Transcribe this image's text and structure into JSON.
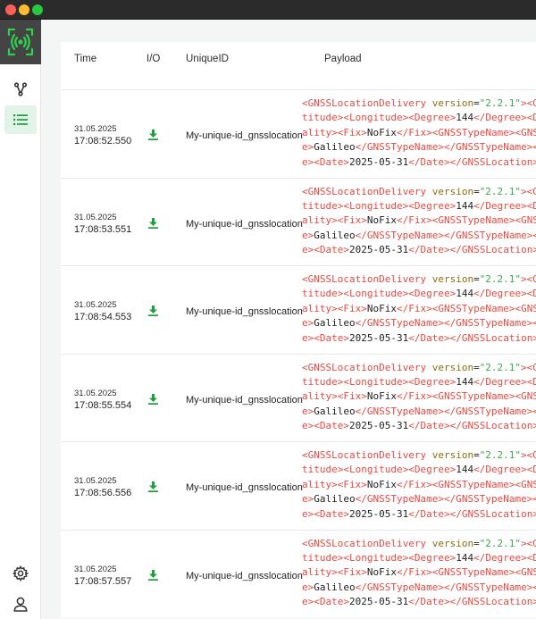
{
  "colors": {
    "accent": "#1f9d3f",
    "tag": "#e14b43",
    "attr": "#8a6d14",
    "string": "#3ea84a"
  },
  "sidebar": {
    "logo_icon": "antenna-scan-icon",
    "items": [
      {
        "name": "graph-icon",
        "active": false
      },
      {
        "name": "list-icon",
        "active": true
      }
    ],
    "bottom": [
      {
        "name": "gear-icon"
      },
      {
        "name": "user-icon"
      }
    ]
  },
  "table": {
    "headers": {
      "time": "Time",
      "io": "I/O",
      "unique_id": "UniqueID",
      "payload": "Payload"
    },
    "rows": [
      {
        "date": "31.05.2025",
        "time": "17:08:52.550",
        "io_icon": "download-icon",
        "unique_id": "My-unique-id_gnsslocation"
      },
      {
        "date": "31.05.2025",
        "time": "17:08:53.551",
        "io_icon": "download-icon",
        "unique_id": "My-unique-id_gnsslocation"
      },
      {
        "date": "31.05.2025",
        "time": "17:08:54.553",
        "io_icon": "download-icon",
        "unique_id": "My-unique-id_gnsslocation"
      },
      {
        "date": "31.05.2025",
        "time": "17:08:55.554",
        "io_icon": "download-icon",
        "unique_id": "My-unique-id_gnsslocation"
      },
      {
        "date": "31.05.2025",
        "time": "17:08:56.556",
        "io_icon": "download-icon",
        "unique_id": "My-unique-id_gnsslocation"
      },
      {
        "date": "31.05.2025",
        "time": "17:08:57.557",
        "io_icon": "download-icon",
        "unique_id": "My-unique-id_gnsslocation"
      }
    ],
    "payload_lines": [
      [
        [
          "t",
          "<"
        ],
        [
          "t",
          "GNSSLocationDelivery"
        ],
        [
          "b",
          " "
        ],
        [
          "a",
          "version"
        ],
        [
          "b",
          "="
        ],
        [
          "s",
          "\"2.2.1\""
        ],
        [
          "t",
          ">"
        ],
        [
          "t",
          "<"
        ],
        [
          "t",
          "GNSS"
        ]
      ],
      [
        [
          "t",
          "titude"
        ],
        [
          "t",
          ">"
        ],
        [
          "t",
          "<"
        ],
        [
          "t",
          "Longitude"
        ],
        [
          "t",
          ">"
        ],
        [
          "t",
          "<"
        ],
        [
          "t",
          "Degree"
        ],
        [
          "t",
          ">"
        ],
        [
          "b",
          "144"
        ],
        [
          "t",
          "</"
        ],
        [
          "t",
          "Degree"
        ],
        [
          "t",
          ">"
        ],
        [
          "t",
          "<"
        ],
        [
          "t",
          "Di"
        ]
      ],
      [
        [
          "t",
          "ality"
        ],
        [
          "t",
          ">"
        ],
        [
          "t",
          "<"
        ],
        [
          "t",
          "Fix"
        ],
        [
          "t",
          ">"
        ],
        [
          "b",
          "NoFix"
        ],
        [
          "t",
          "</"
        ],
        [
          "t",
          "Fix"
        ],
        [
          "t",
          ">"
        ],
        [
          "t",
          "<"
        ],
        [
          "t",
          "GNSSTypeName"
        ],
        [
          "t",
          ">"
        ],
        [
          "t",
          "<"
        ],
        [
          "t",
          "GNSST"
        ]
      ],
      [
        [
          "t",
          "e"
        ],
        [
          "t",
          ">"
        ],
        [
          "b",
          "Galileo"
        ],
        [
          "t",
          "</"
        ],
        [
          "t",
          "GNSSTypeName"
        ],
        [
          "t",
          ">"
        ],
        [
          "t",
          "</"
        ],
        [
          "t",
          "GNSSTypeName"
        ],
        [
          "t",
          ">"
        ],
        [
          "t",
          "<"
        ],
        [
          "t",
          "GN"
        ]
      ],
      [
        [
          "t",
          "e"
        ],
        [
          "t",
          ">"
        ],
        [
          "t",
          "<"
        ],
        [
          "t",
          "Date"
        ],
        [
          "t",
          ">"
        ],
        [
          "b",
          "2025-05-31"
        ],
        [
          "t",
          "</"
        ],
        [
          "t",
          "Date"
        ],
        [
          "t",
          ">"
        ],
        [
          "t",
          "</"
        ],
        [
          "t",
          "GNSSLocation"
        ],
        [
          "t",
          ">"
        ],
        [
          "t",
          "<"
        ]
      ]
    ]
  }
}
